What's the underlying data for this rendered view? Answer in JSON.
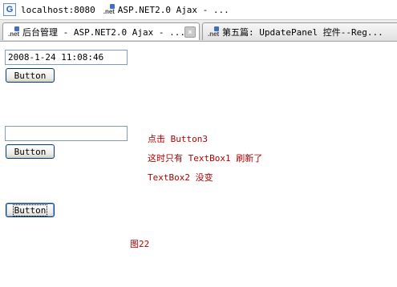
{
  "window": {
    "site": "localhost:8080",
    "title": "ASP.NET2.0 Ajax - ..."
  },
  "tabs": [
    {
      "label": "后台管理 - ASP.NET2.0 Ajax - ...",
      "active": true
    },
    {
      "label": "第五篇: UpdatePanel 控件--Reg...",
      "active": false
    }
  ],
  "form": {
    "textbox1_value": "2008-1-24 11:08:46",
    "button1_label": "Button",
    "textbox2_value": "",
    "button2_label": "Button",
    "button3_label": "Button"
  },
  "notes": [
    "点击 Button3",
    "这时只有 TextBox1 刷新了",
    "TextBox2 没变"
  ],
  "caption": "图22",
  "colors": {
    "note_text": "#b00000",
    "button_border": "#003c74",
    "textbox_border": "#7f9db9"
  },
  "icons": {
    "site": "google-g-icon",
    "page": "dotnet-icon",
    "close": "close-icon"
  }
}
